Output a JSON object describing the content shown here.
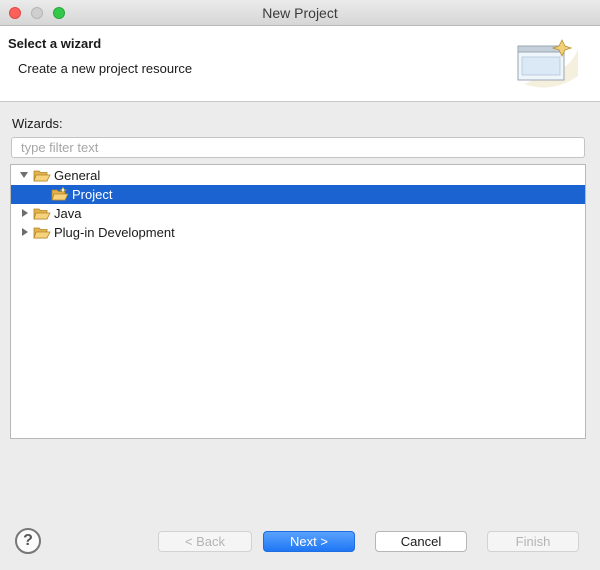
{
  "window": {
    "title": "New Project"
  },
  "header": {
    "title": "Select a wizard",
    "description": "Create a new project resource"
  },
  "wizards": {
    "label": "Wizards:",
    "filter_placeholder": "type filter text",
    "filter_value": ""
  },
  "tree": {
    "items": [
      {
        "label": "General",
        "expanded": true,
        "icon": "folder-open-icon"
      },
      {
        "label": "Project",
        "selected": true,
        "icon": "project-wizard-icon"
      },
      {
        "label": "Java",
        "expanded": false,
        "icon": "folder-icon"
      },
      {
        "label": "Plug-in Development",
        "expanded": false,
        "icon": "folder-icon"
      }
    ]
  },
  "buttons": {
    "help": "?",
    "back": "< Back",
    "next": "Next >",
    "cancel": "Cancel",
    "finish": "Finish"
  },
  "colors": {
    "selection": "#1b63d1",
    "primary_button": "#1f77f5",
    "folder": "#f0c060"
  }
}
